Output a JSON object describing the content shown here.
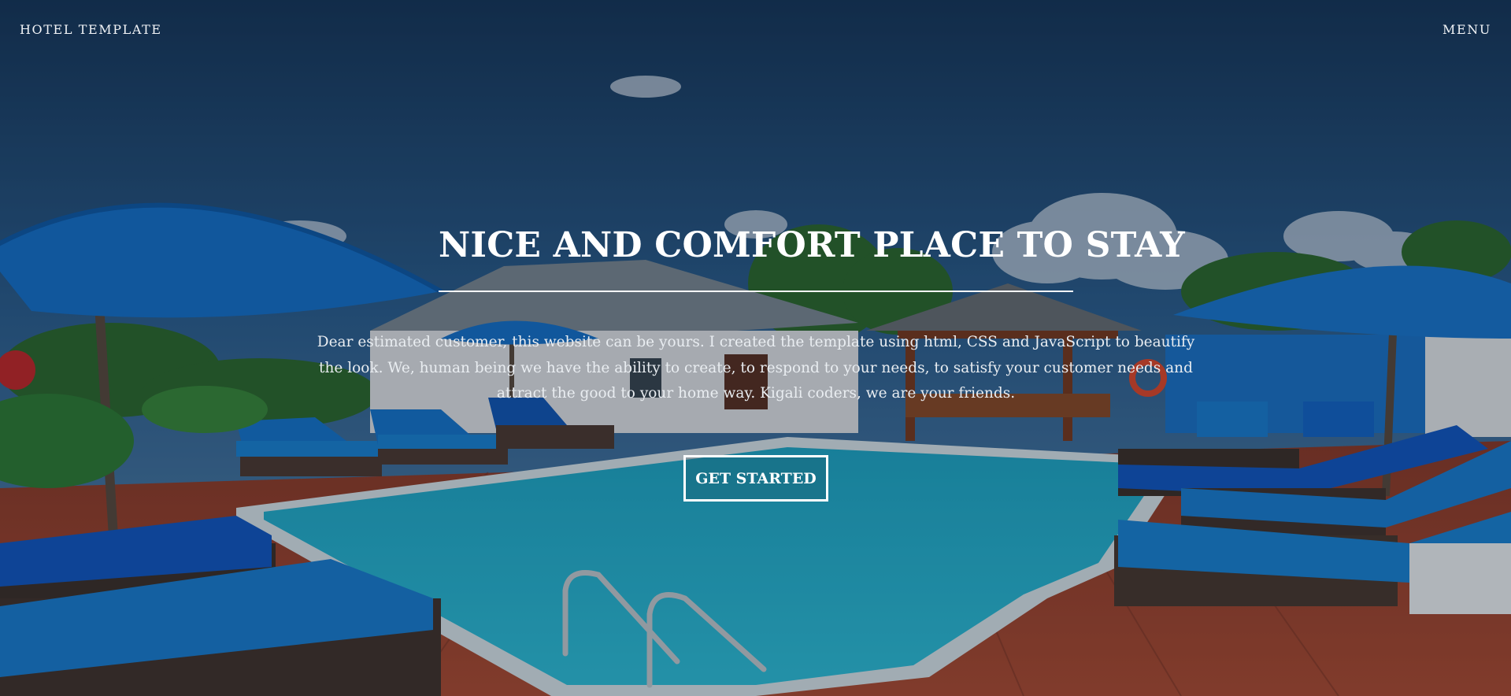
{
  "nav": {
    "brand": "HOTEL TEMPLATE",
    "menu_label": "MENU"
  },
  "hero": {
    "title": "NICE AND COMFORT PLACE TO STAY",
    "description": "Dear estimated customer, this website can be yours. I created the template using html, CSS and JavaScript to beautify the look. We, human being we have the ability to create, to respond to your needs, to satisfy your customer needs and attract the good to your home way. Kigali coders, we are your friends.",
    "cta_label": "GET STARTED",
    "background": "resort-pool-scene"
  },
  "colors": {
    "overlay": "#081220",
    "text": "#ffffff",
    "sky": "#2c5f8f",
    "pool": "#1fb4d0",
    "deck": "#a2442c",
    "umbrella": "#1467c7"
  }
}
